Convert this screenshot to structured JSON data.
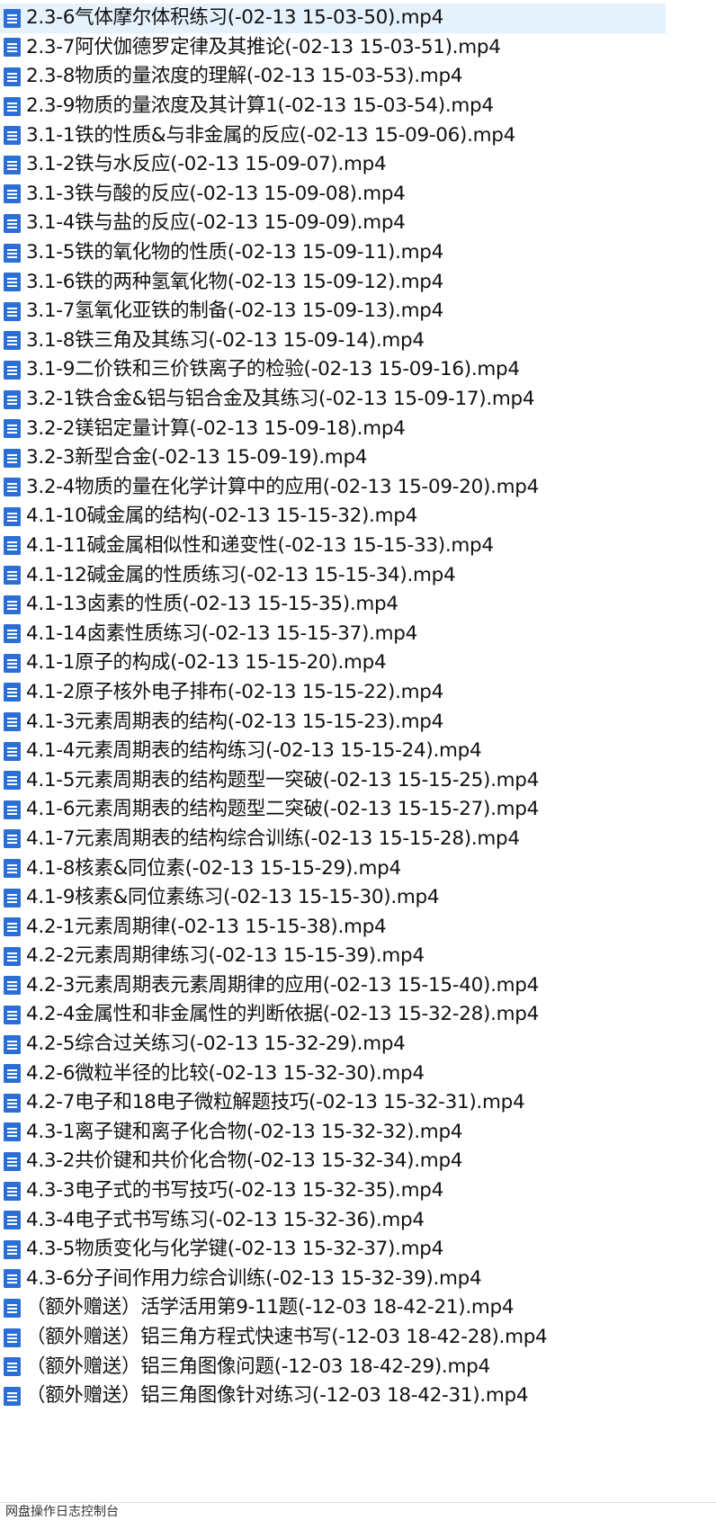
{
  "colors": {
    "icon_blue": "#2b6fd6",
    "icon_line": "#ffffff",
    "selection": "#e5f1fb"
  },
  "file_icon": "document-icon",
  "files": [
    "2.3-6气体摩尔体积练习(-02-13 15-03-50).mp4",
    "2.3-7阿伏伽德罗定律及其推论(-02-13 15-03-51).mp4",
    "2.3-8物质的量浓度的理解(-02-13 15-03-53).mp4",
    "2.3-9物质的量浓度及其计算1(-02-13 15-03-54).mp4",
    "3.1-1铁的性质&与非金属的反应(-02-13 15-09-06).mp4",
    "3.1-2铁与水反应(-02-13 15-09-07).mp4",
    "3.1-3铁与酸的反应(-02-13 15-09-08).mp4",
    "3.1-4铁与盐的反应(-02-13 15-09-09).mp4",
    "3.1-5铁的氧化物的性质(-02-13 15-09-11).mp4",
    "3.1-6铁的两种氢氧化物(-02-13 15-09-12).mp4",
    "3.1-7氢氧化亚铁的制备(-02-13 15-09-13).mp4",
    "3.1-8铁三角及其练习(-02-13 15-09-14).mp4",
    "3.1-9二价铁和三价铁离子的检验(-02-13 15-09-16).mp4",
    "3.2-1铁合金&铝与铝合金及其练习(-02-13 15-09-17).mp4",
    "3.2-2镁铝定量计算(-02-13 15-09-18).mp4",
    "3.2-3新型合金(-02-13 15-09-19).mp4",
    "3.2-4物质的量在化学计算中的应用(-02-13 15-09-20).mp4",
    "4.1-10碱金属的结构(-02-13 15-15-32).mp4",
    "4.1-11碱金属相似性和递变性(-02-13 15-15-33).mp4",
    "4.1-12碱金属的性质练习(-02-13 15-15-34).mp4",
    "4.1-13卤素的性质(-02-13 15-15-35).mp4",
    "4.1-14卤素性质练习(-02-13 15-15-37).mp4",
    "4.1-1原子的构成(-02-13 15-15-20).mp4",
    "4.1-2原子核外电子排布(-02-13 15-15-22).mp4",
    "4.1-3元素周期表的结构(-02-13 15-15-23).mp4",
    "4.1-4元素周期表的结构练习(-02-13 15-15-24).mp4",
    "4.1-5元素周期表的结构题型一突破(-02-13 15-15-25).mp4",
    "4.1-6元素周期表的结构题型二突破(-02-13 15-15-27).mp4",
    "4.1-7元素周期表的结构综合训练(-02-13 15-15-28).mp4",
    "4.1-8核素&同位素(-02-13 15-15-29).mp4",
    "4.1-9核素&同位素练习(-02-13 15-15-30).mp4",
    "4.2-1元素周期律(-02-13 15-15-38).mp4",
    "4.2-2元素周期律练习(-02-13 15-15-39).mp4",
    "4.2-3元素周期表元素周期律的应用(-02-13 15-15-40).mp4",
    "4.2-4金属性和非金属性的判断依据(-02-13 15-32-28).mp4",
    "4.2-5综合过关练习(-02-13 15-32-29).mp4",
    "4.2-6微粒半径的比较(-02-13 15-32-30).mp4",
    "4.2-7电子和18电子微粒解题技巧(-02-13 15-32-31).mp4",
    "4.3-1离子键和离子化合物(-02-13 15-32-32).mp4",
    "4.3-2共价键和共价化合物(-02-13 15-32-34).mp4",
    "4.3-3电子式的书写技巧(-02-13 15-32-35).mp4",
    "4.3-4电子式书写练习(-02-13 15-32-36).mp4",
    "4.3-5物质变化与化学键(-02-13 15-32-37).mp4",
    "4.3-6分子间作用力综合训练(-02-13 15-32-39).mp4",
    "（额外赠送）活学活用第9-11题(-12-03 18-42-21).mp4",
    "（额外赠送）铝三角方程式快速书写(-12-03 18-42-28).mp4",
    "（额外赠送）铝三角图像问题(-12-03 18-42-29).mp4",
    "（额外赠送）铝三角图像针对练习(-12-03 18-42-31).mp4"
  ],
  "status_bar": {
    "label": "网盘操作日志控制台"
  }
}
